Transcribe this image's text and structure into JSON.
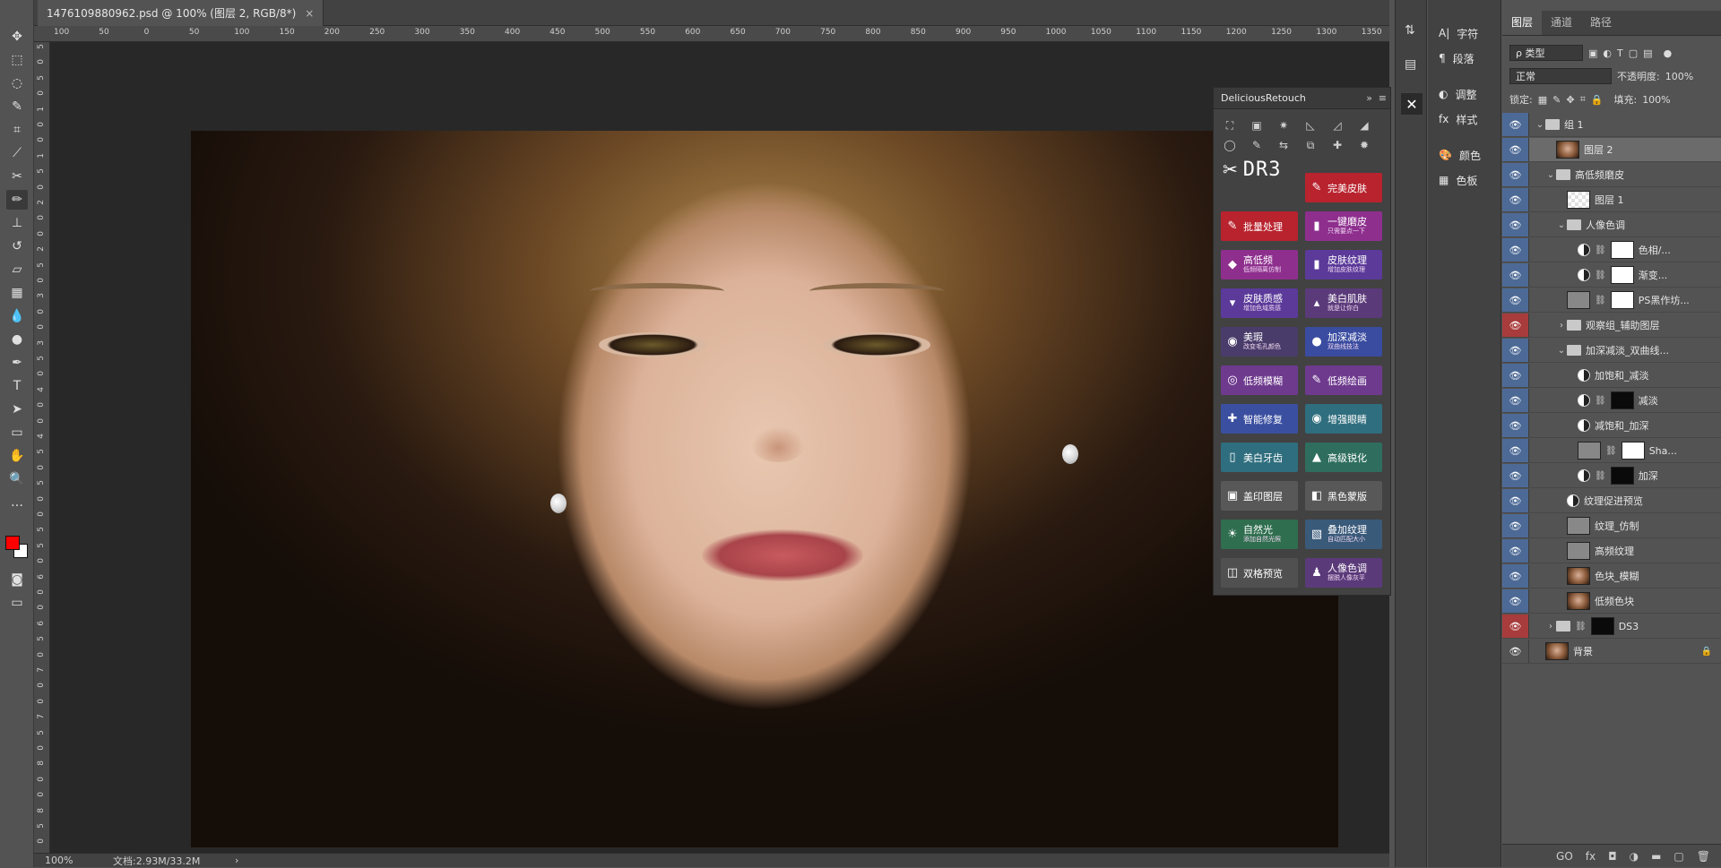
{
  "document": {
    "tab_title": "1476109880962.psd @ 100% (图层 2, RGB/8*)",
    "close_glyph": "×"
  },
  "ruler": {
    "top_ticks": [
      "100",
      "50",
      "0",
      "50",
      "100",
      "150",
      "200",
      "250",
      "300",
      "350",
      "400",
      "450",
      "500",
      "550",
      "600",
      "650",
      "700",
      "750",
      "800",
      "850",
      "900",
      "950",
      "1000",
      "1050",
      "1100",
      "1150",
      "1200",
      "1250",
      "1300",
      "1350"
    ],
    "left_ticks": [
      "5",
      "0",
      "5",
      "0",
      "1",
      "0",
      "0",
      "1",
      "5",
      "0",
      "2",
      "0",
      "0",
      "2",
      "5",
      "0",
      "3",
      "0",
      "0",
      "3",
      "5",
      "0",
      "4",
      "0",
      "0",
      "4",
      "5",
      "0",
      "5",
      "0",
      "0",
      "5",
      "5",
      "0",
      "6",
      "0",
      "0",
      "6",
      "5",
      "0",
      "7",
      "0",
      "0",
      "7",
      "5",
      "0",
      "8",
      "0",
      "0",
      "8",
      "5",
      "0"
    ]
  },
  "status": {
    "zoom": "100%",
    "doc_size": "文档:2.93M/33.2M",
    "arrow": "›"
  },
  "toolbar": {
    "tools": [
      {
        "name": "move-tool",
        "glyph": "✥"
      },
      {
        "name": "marquee-tool",
        "glyph": "⬚"
      },
      {
        "name": "lasso-tool",
        "glyph": "◌"
      },
      {
        "name": "quick-select-tool",
        "glyph": "✎"
      },
      {
        "name": "crop-tool",
        "glyph": "⌗"
      },
      {
        "name": "eyedropper-tool",
        "glyph": "⟋"
      },
      {
        "name": "healing-tool",
        "glyph": "✂"
      },
      {
        "name": "brush-tool",
        "glyph": "✏"
      },
      {
        "name": "stamp-tool",
        "glyph": "⊥"
      },
      {
        "name": "history-brush-tool",
        "glyph": "↺"
      },
      {
        "name": "eraser-tool",
        "glyph": "▱"
      },
      {
        "name": "gradient-tool",
        "glyph": "▦"
      },
      {
        "name": "blur-tool",
        "glyph": "💧"
      },
      {
        "name": "dodge-tool",
        "glyph": "●"
      },
      {
        "name": "pen-tool",
        "glyph": "✒"
      },
      {
        "name": "type-tool",
        "glyph": "T"
      },
      {
        "name": "path-select-tool",
        "glyph": "➤"
      },
      {
        "name": "shape-tool",
        "glyph": "▭"
      },
      {
        "name": "hand-tool",
        "glyph": "✋"
      },
      {
        "name": "zoom-tool",
        "glyph": "🔍"
      },
      {
        "name": "more-tools",
        "glyph": "…"
      }
    ],
    "foreground_color": "#ff0000",
    "background_color": "#ffffff"
  },
  "dr3": {
    "title": "DeliciousRetouch",
    "logo": "DR3",
    "buttons": [
      {
        "label": "完美皮肤",
        "sub": "",
        "color": "#b8232e",
        "icon": "✎"
      },
      {
        "label": "批量处理",
        "sub": "",
        "color": "#b8232e",
        "icon": "✎"
      },
      {
        "label": "一键磨皮",
        "sub": "只需要点一下",
        "color": "#8e2f8e",
        "icon": "▮"
      },
      {
        "label": "高低频",
        "sub": "低频隔离仿制",
        "color": "#8e2f8e",
        "icon": "◆"
      },
      {
        "label": "皮肤纹理",
        "sub": "增加皮肤纹理",
        "color": "#5b3a9a",
        "icon": "▮"
      },
      {
        "label": "皮肤质感",
        "sub": "增加色域质感",
        "color": "#5b3a9a",
        "icon": "▾"
      },
      {
        "label": "美白肌肤",
        "sub": "就是让你白",
        "color": "#5b3a7a",
        "icon": "▴"
      },
      {
        "label": "美瑕",
        "sub": "改变毛孔颜色",
        "color": "#4a3c6a",
        "icon": "◉"
      },
      {
        "label": "加深减淡",
        "sub": "双曲线技法",
        "color": "#3a4ca0",
        "icon": "●"
      },
      {
        "label": "低频模糊",
        "sub": "",
        "color": "#6e3a8e",
        "icon": "◎"
      },
      {
        "label": "低频绘画",
        "sub": "",
        "color": "#6e3a8e",
        "icon": "✎"
      },
      {
        "label": "智能修复",
        "sub": "",
        "color": "#3a4fa0",
        "icon": "✚"
      },
      {
        "label": "增强眼睛",
        "sub": "",
        "color": "#2f6e7e",
        "icon": "◉"
      },
      {
        "label": "美白牙齿",
        "sub": "",
        "color": "#2f6e7e",
        "icon": "▯"
      },
      {
        "label": "高级锐化",
        "sub": "",
        "color": "#2f6e5e",
        "icon": "▲"
      },
      {
        "label": "盖印图层",
        "sub": "",
        "color": "#585858",
        "icon": "▣"
      },
      {
        "label": "黑色蒙版",
        "sub": "",
        "color": "#585858",
        "icon": "◧"
      },
      {
        "label": "自然光",
        "sub": "添加自然光照",
        "color": "#2f6e4e",
        "icon": "☀"
      },
      {
        "label": "叠加纹理",
        "sub": "自动匹配大小",
        "color": "#3a5a7a",
        "icon": "▧"
      },
      {
        "label": "双格预览",
        "sub": "",
        "color": "#505050",
        "icon": "◫"
      },
      {
        "label": "人像色调",
        "sub": "摆脱人像灰平",
        "color": "#5b3a7a",
        "icon": "♟"
      }
    ]
  },
  "dock1": {
    "icons": [
      "history-icon",
      "properties-icon",
      "dr3-icon"
    ]
  },
  "dock2": {
    "items": [
      {
        "icon": "A|",
        "label": "字符"
      },
      {
        "icon": "¶",
        "label": "段落"
      },
      {
        "icon": "◐",
        "label": "调整"
      },
      {
        "icon": "fx",
        "label": "样式"
      },
      {
        "icon": "🎨",
        "label": "颜色"
      },
      {
        "icon": "▦",
        "label": "色板"
      }
    ]
  },
  "layers_panel": {
    "tabs": [
      "图层",
      "通道",
      "路径"
    ],
    "filter_label": "ρ 类型",
    "blend_mode": "正常",
    "opacity_label": "不透明度:",
    "opacity_value": "100%",
    "lock_label": "锁定:",
    "fill_label": "填充:",
    "fill_value": "100%",
    "layers": [
      {
        "name": "组 1",
        "kind": "group",
        "indent": 0,
        "eye": "blue",
        "arrow": "⌄"
      },
      {
        "name": "图层 2",
        "kind": "face",
        "indent": 1,
        "eye": "blue",
        "selected": true
      },
      {
        "name": "高低频磨皮",
        "kind": "group",
        "indent": 1,
        "eye": "blue",
        "arrow": "⌄"
      },
      {
        "name": "图层 1",
        "kind": "checker",
        "indent": 2,
        "eye": "blue"
      },
      {
        "name": "人像色调",
        "kind": "group",
        "indent": 2,
        "eye": "blue",
        "arrow": "⌄"
      },
      {
        "name": "色相/...",
        "kind": "adj-white",
        "indent": 3,
        "eye": "blue"
      },
      {
        "name": "渐变...",
        "kind": "adj-white",
        "indent": 3,
        "eye": "blue"
      },
      {
        "name": "PS黑作坊...",
        "kind": "gray-white",
        "indent": 2,
        "eye": "blue"
      },
      {
        "name": "观察组_辅助图层",
        "kind": "group",
        "indent": 2,
        "eye": "red",
        "arrow": "›"
      },
      {
        "name": "加深减淡_双曲线...",
        "kind": "group",
        "indent": 2,
        "eye": "blue",
        "arrow": "⌄"
      },
      {
        "name": "加饱和_减淡",
        "kind": "adj",
        "indent": 3,
        "eye": "blue"
      },
      {
        "name": "减淡",
        "kind": "adj-black",
        "indent": 3,
        "eye": "blue"
      },
      {
        "name": "减饱和_加深",
        "kind": "adj",
        "indent": 3,
        "eye": "blue"
      },
      {
        "name": "Sha...",
        "kind": "gray-white",
        "indent": 3,
        "eye": "blue"
      },
      {
        "name": "加深",
        "kind": "adj-black",
        "indent": 3,
        "eye": "blue"
      },
      {
        "name": "纹理促进预览",
        "kind": "adj",
        "indent": 2,
        "eye": "blue"
      },
      {
        "name": "纹理_仿制",
        "kind": "gray",
        "indent": 2,
        "eye": "blue"
      },
      {
        "name": "高频纹理",
        "kind": "gray",
        "indent": 2,
        "eye": "blue"
      },
      {
        "name": "色块_模糊",
        "kind": "face",
        "indent": 2,
        "eye": "blue"
      },
      {
        "name": "低频色块",
        "kind": "face",
        "indent": 2,
        "eye": "blue"
      },
      {
        "name": "DS3",
        "kind": "group-mask",
        "indent": 1,
        "eye": "red",
        "arrow": "›"
      },
      {
        "name": "背景",
        "kind": "face",
        "indent": 0,
        "eye": "plain",
        "lock": "🔒"
      }
    ],
    "footer_icons": [
      "GO",
      "fx",
      "◘",
      "◑",
      "▬",
      "▢",
      "🗑"
    ]
  }
}
